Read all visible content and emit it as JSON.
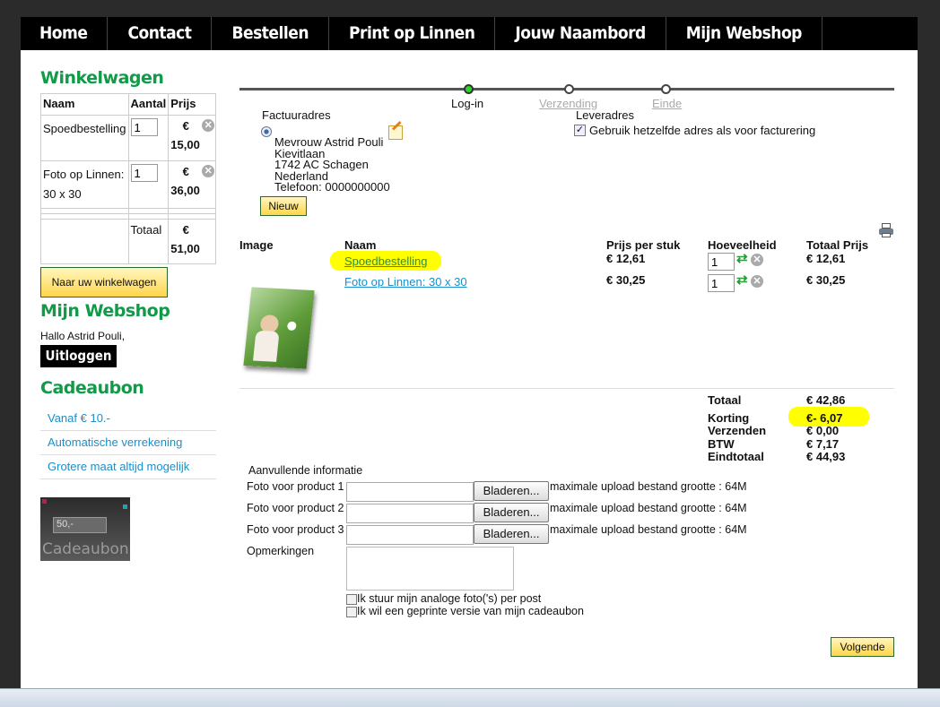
{
  "nav": [
    "Home",
    "Contact",
    "Bestellen",
    "Print op Linnen",
    "Jouw Naambord",
    "Mijn Webshop"
  ],
  "sidebar": {
    "cart_title": "Winkelwagen",
    "cart_headers": [
      "Naam",
      "Aantal",
      "Prijs"
    ],
    "cart_items": [
      {
        "name": "Spoedbestelling",
        "qty": "1",
        "currency": "€",
        "price": "15,00"
      },
      {
        "name": "Foto op Linnen: 30 x 30",
        "qty": "1",
        "currency": "€",
        "price": "36,00"
      }
    ],
    "total_label": "Totaal",
    "total_currency": "€",
    "total_value": "51,00",
    "cart_button": "Naar uw winkelwagen",
    "webshop_title": "Mijn Webshop",
    "greeting": "Hallo Astrid Pouli,",
    "logout": "Uitloggen",
    "gift_title": "Cadeaubon",
    "gift_links": [
      "Vanaf € 10.-",
      "Automatische verrekening",
      "Grotere maat altijd mogelijk"
    ],
    "gift_image_text": "Cadeaubon",
    "gift_image_price": "50,-"
  },
  "steps": [
    "Log-in",
    "Verzending",
    "Einde"
  ],
  "billing": {
    "label": "Factuuradres",
    "lines": [
      "Mevrouw Astrid Pouli",
      "Kievitlaan",
      "1742 AC Schagen",
      "Nederland",
      "Telefoon: 0000000000"
    ],
    "new_button": "Nieuw"
  },
  "delivery": {
    "label": "Leveradres",
    "same_address": "Gebruik hetzelfde adres als voor facturering"
  },
  "products": {
    "headers": [
      "Image",
      "Naam",
      "Prijs per stuk",
      "Hoeveelheid",
      "Totaal Prijs"
    ],
    "rows": [
      {
        "name": "Spoedbestelling",
        "unit": "€ 12,61",
        "qty": "1",
        "total": "€ 12,61"
      },
      {
        "name": "Foto op Linnen: 30 x 30",
        "unit": "€ 30,25",
        "qty": "1",
        "total": "€ 30,25"
      }
    ]
  },
  "totals": [
    {
      "label": "Totaal",
      "value": "€ 42,86"
    },
    {
      "label": "Korting",
      "value": "€- 6,07"
    },
    {
      "label": "Verzenden",
      "value": "€ 0,00"
    },
    {
      "label": "BTW",
      "value": "€ 7,17"
    },
    {
      "label": "Eindtotaal",
      "value": "€ 44,93"
    }
  ],
  "extra": {
    "title": "Aanvullende informatie",
    "uploads": [
      {
        "label": "Foto voor product 1",
        "button": "Bladeren...",
        "note": "maximale upload bestand grootte : 64M"
      },
      {
        "label": "Foto voor product 2",
        "button": "Bladeren...",
        "note": "maximale upload bestand grootte : 64M"
      },
      {
        "label": "Foto voor product 3",
        "button": "Bladeren...",
        "note": "maximale upload bestand grootte : 64M"
      }
    ],
    "remarks": "Opmerkingen",
    "checks": [
      "Ik stuur mijn analoge foto('s) per post",
      "Ik wil een geprinte versie van mijn cadeaubon"
    ]
  },
  "next_button": "Volgende",
  "colors": {
    "green": "#119a48",
    "link": "#1a8fc9",
    "highlight": "#ffff00"
  }
}
